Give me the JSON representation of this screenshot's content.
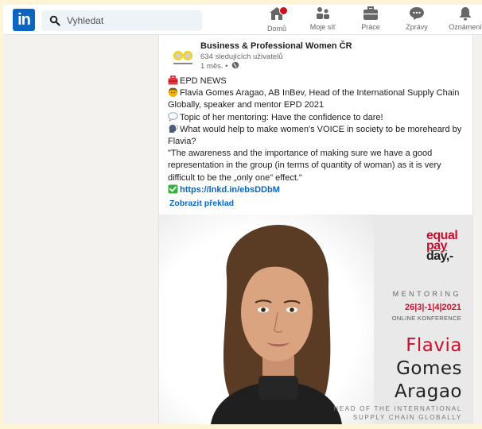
{
  "colors": {
    "brand": "#0a66c2",
    "badge": "#cc1016",
    "accent_red": "#c8102e",
    "page_bg": "#f3f2ef"
  },
  "navbar": {
    "logo_text": "in",
    "search_placeholder": "Vyhledat",
    "items": [
      {
        "label": "Domů",
        "icon": "home-icon",
        "has_badge": true
      },
      {
        "label": "Moje síť",
        "icon": "network-icon",
        "has_badge": false
      },
      {
        "label": "Práce",
        "icon": "briefcase-icon",
        "has_badge": false
      },
      {
        "label": "Zprávy",
        "icon": "chat-icon",
        "has_badge": false
      },
      {
        "label": "Oznámení",
        "icon": "bell-icon",
        "has_badge": false
      }
    ]
  },
  "post": {
    "company_name": "Business & Professional Women ČR",
    "followers": "634 sledujících uživatelů",
    "time": "1 měs. •",
    "lines": [
      {
        "emoji": "toolbox-icon",
        "text": "EPD NEWS"
      },
      {
        "emoji": "woman-icon",
        "text": "Flavia Gomes Aragao, AB InBev, Head of the International Supply Chain Globally, speaker and mentor EPD 2021"
      },
      {
        "emoji": "speech-bubble-icon",
        "text": "Topic of her mentoring: Have the confidence to dare!"
      },
      {
        "emoji": "speaking-head-icon",
        "text": "What would help to make women's VOICE in society to be moreheard by Flavia?"
      },
      {
        "emoji": "",
        "text": "\"The awareness and the importance of making sure we have a good representation in the group (in terms of quantity of woman) as it is very difficult to be the „only one\" effect.\""
      }
    ],
    "link": "https://lnkd.in/ebsDDbM",
    "translate_label": "Zobrazit překlad"
  },
  "image": {
    "logo_line1": "equal",
    "logo_line2": "pay",
    "logo_line3": "day,-",
    "mentoring": "MENTORING",
    "date": "26|3|-1|4|2021",
    "subtitle": "ONLINE KONFERENCE",
    "name_first": "Flavia",
    "name_middle": "Gomes",
    "name_last": "Aragao",
    "role_line1": "HEAD OF THE INTERNATIONAL",
    "role_line2": "SUPPLY CHAIN GLOBALLY"
  }
}
